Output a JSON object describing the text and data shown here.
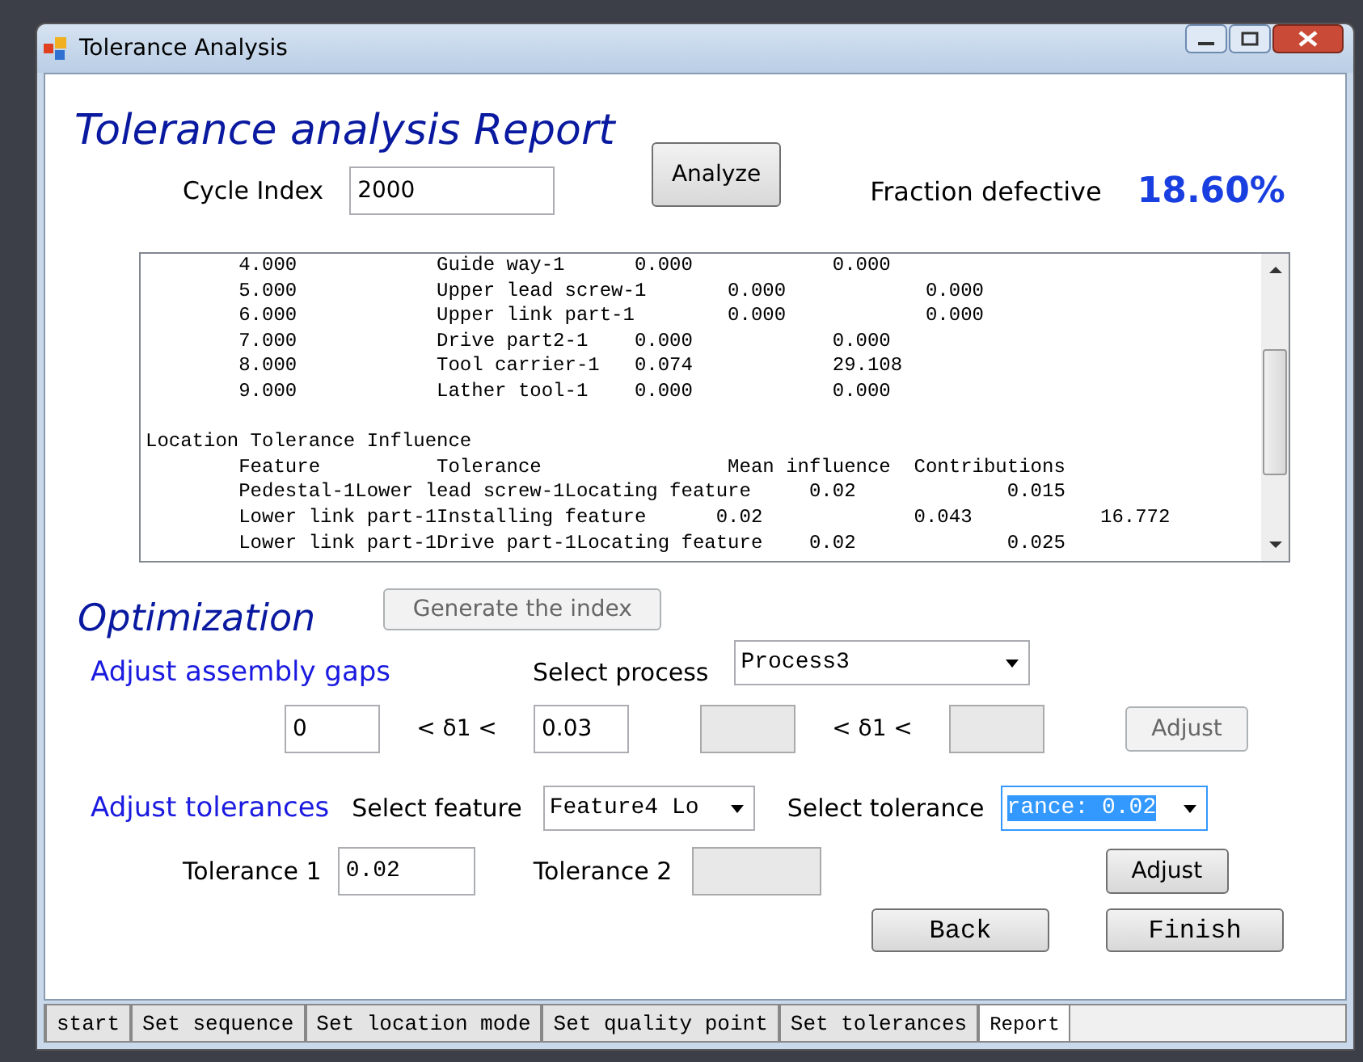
{
  "window": {
    "title": "Tolerance Analysis"
  },
  "heading": "Tolerance analysis Report",
  "cycle_index": {
    "label": "Cycle Index",
    "value": "2000"
  },
  "analyze_button": {
    "label": "Analyze",
    "disabled": false
  },
  "fraction_defective": {
    "label": "Fraction defective",
    "value": "18.60%"
  },
  "report_lines": [
    {
      "kind": "row",
      "text": "        4.000            Guide way-1      0.000            0.000"
    },
    {
      "kind": "row",
      "text": "        5.000            Upper lead screw-1       0.000            0.000"
    },
    {
      "kind": "row",
      "text": "        6.000            Upper link part-1        0.000            0.000"
    },
    {
      "kind": "row",
      "text": "        7.000            Drive part2-1    0.000            0.000"
    },
    {
      "kind": "row",
      "text": "        8.000            Tool carrier-1   0.074            29.108"
    },
    {
      "kind": "row",
      "text": "        9.000            Lather tool-1    0.000            0.000"
    },
    {
      "kind": "heading",
      "text": "Location Tolerance Influence"
    },
    {
      "kind": "row",
      "text": "        Feature          Tolerance                Mean influence  Contributions"
    },
    {
      "kind": "row",
      "text": "        Pedestal-1Lower lead screw-1Locating feature     0.02             0.015"
    },
    {
      "kind": "row",
      "text": "        Lower link part-1Installing feature      0.02             0.043           16.772"
    },
    {
      "kind": "row",
      "text": "        Lower link part-1Drive part-1Locating feature    0.02             0.025"
    }
  ],
  "optimization": {
    "heading": "Optimization",
    "generate_button": {
      "label": "Generate the index",
      "disabled": true
    }
  },
  "assembly_gaps": {
    "heading": "Adjust assembly gaps",
    "process_label": "Select process",
    "process_value": "Process3",
    "bounds": [
      {
        "lower": "0",
        "symbol": "< δ1 <",
        "upper": "0.03",
        "disabled": false
      },
      {
        "symbol": "< δ1 <",
        "disabled": true
      }
    ],
    "adjust_button": {
      "label": "Adjust",
      "disabled": true
    }
  },
  "adjust_tolerances": {
    "heading": "Adjust tolerances",
    "feature_label": "Select feature",
    "feature_value": "Feature4 Lo",
    "tolerance_label": "Select tolerance",
    "tolerance_value": "rance: 0.02",
    "tolerance_focused": true,
    "tolerance_1": {
      "label": "Tolerance 1",
      "value": "0.02",
      "disabled": false
    },
    "tolerance_2": {
      "label": "Tolerance 2",
      "disabled": true
    },
    "adjust_button": {
      "label": "Adjust",
      "disabled": false
    }
  },
  "nav_buttons": [
    {
      "label": "Back"
    },
    {
      "label": "Finish"
    }
  ],
  "tabs": [
    {
      "label": "start",
      "selected": false
    },
    {
      "label": "Set sequence",
      "selected": false
    },
    {
      "label": "Set location mode",
      "selected": false
    },
    {
      "label": "Set quality point",
      "selected": false
    },
    {
      "label": "Set tolerances",
      "selected": false
    },
    {
      "label": "Report",
      "selected": true
    }
  ]
}
